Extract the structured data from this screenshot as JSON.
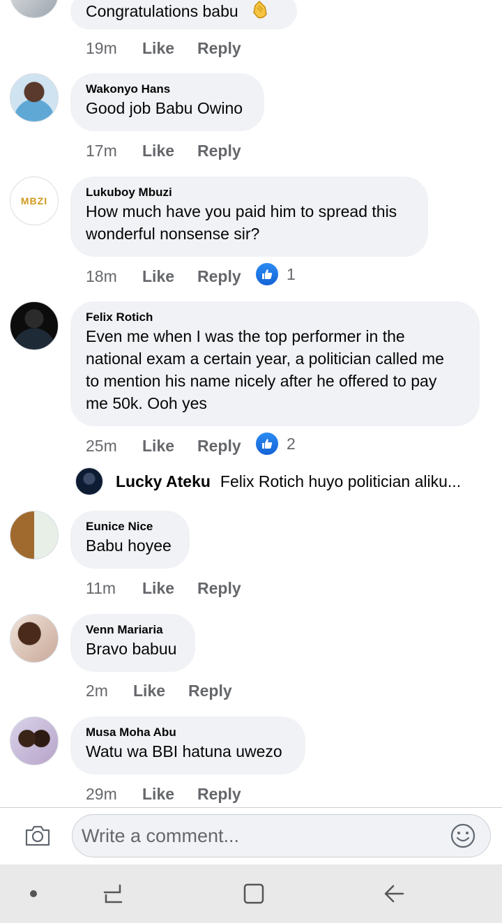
{
  "comments": [
    {
      "author": "",
      "text": "Congratulations babu",
      "time": "19m",
      "like": "Like",
      "reply": "Reply"
    },
    {
      "author": "Wakonyo Hans",
      "text": "Good job Babu Owino",
      "time": "17m",
      "like": "Like",
      "reply": "Reply"
    },
    {
      "author": "Lukuboy Mbuzi",
      "text_lines": [
        "How much have you paid him to spread this",
        "wonderful nonsense sir?"
      ],
      "time": "18m",
      "like": "Like",
      "reply": "Reply",
      "reactions": "1",
      "avatar_logo": "MBZI"
    },
    {
      "author": "Felix Rotich",
      "text_lines": [
        "Even me when I was the top performer in the",
        "national exam a certain year, a politician called me",
        "to mention his name nicely after he offered to pay",
        "me 50k. Ooh yes"
      ],
      "time": "25m",
      "like": "Like",
      "reply": "Reply",
      "reactions": "2"
    },
    {
      "author": "Eunice Nice",
      "text": "Babu hoyee",
      "time": "11m",
      "like": "Like",
      "reply": "Reply"
    },
    {
      "author": "Venn Mariaria",
      "text": "Bravo babuu",
      "time": "2m",
      "like": "Like",
      "reply": "Reply"
    },
    {
      "author": "Musa Moha Abu",
      "text": "Watu wa BBI hatuna uwezo",
      "time": "29m",
      "like": "Like",
      "reply": "Reply"
    }
  ],
  "reply_preview": {
    "author": "Lucky Ateku",
    "text": "Felix Rotich huyo politician aliku..."
  },
  "composer": {
    "placeholder": "Write a comment..."
  },
  "colors": {
    "bubble": "#f0f2f5",
    "meta": "#65676b",
    "like_blue": "#1877f2"
  },
  "icons": [
    "camera-icon",
    "emoji-icon",
    "thumbs-up-icon",
    "clap-emoji-icon",
    "nav-dot-icon",
    "recents-icon",
    "home-icon",
    "back-icon"
  ]
}
